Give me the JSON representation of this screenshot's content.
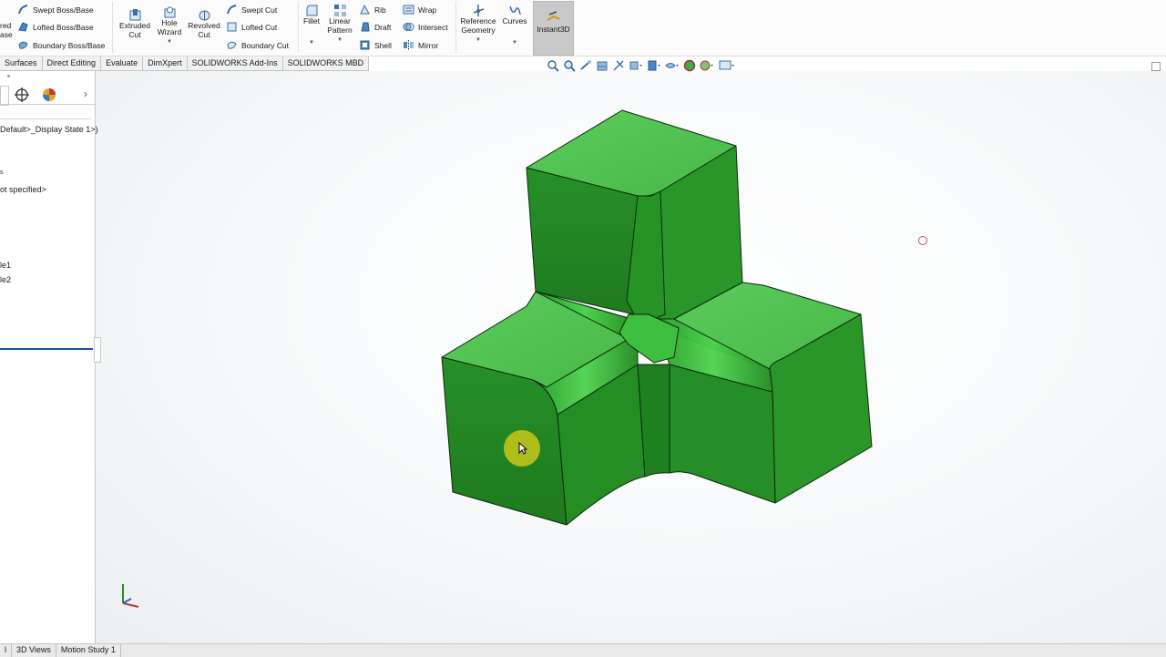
{
  "ribbon": {
    "features_col1": [
      "Swept Boss/Base",
      "Lofted Boss/Base",
      "Boundary Boss/Base"
    ],
    "features_cut_left_top": "red",
    "features_cut_left_bot": "ase",
    "extruded_cut": "Extruded\nCut",
    "hole_wizard": "Hole\nWizard",
    "revolved_cut": "Revolved\nCut",
    "cuts_col": [
      "Swept Cut",
      "Lofted Cut",
      "Boundary Cut"
    ],
    "fillet": "Fillet",
    "linear_pattern": "Linear\nPattern",
    "rib_col": [
      "Rib",
      "Draft",
      "Shell"
    ],
    "wrap_col": [
      "Wrap",
      "Intersect",
      "Mirror"
    ],
    "reference_geometry": "Reference\nGeometry",
    "curves": "Curves",
    "instant3d": "Instant3D"
  },
  "tabs": [
    "Surfaces",
    "Direct Editing",
    "Evaluate",
    "DimXpert",
    "SOLIDWORKS Add-Ins",
    "SOLIDWORKS MBD"
  ],
  "tree": {
    "display_state": "Default>_Display State 1>)",
    "line_s": "s",
    "material": "ot specified>",
    "plane1": "le1",
    "plane2": "le2"
  },
  "bottom_tabs": [
    "l",
    "3D Views",
    "Motion Study 1"
  ],
  "colors": {
    "model_green": "#2e9a2e",
    "model_top": "#52c452",
    "edge": "#0c2a0c",
    "cursor_highlight": "#c9c81a"
  }
}
